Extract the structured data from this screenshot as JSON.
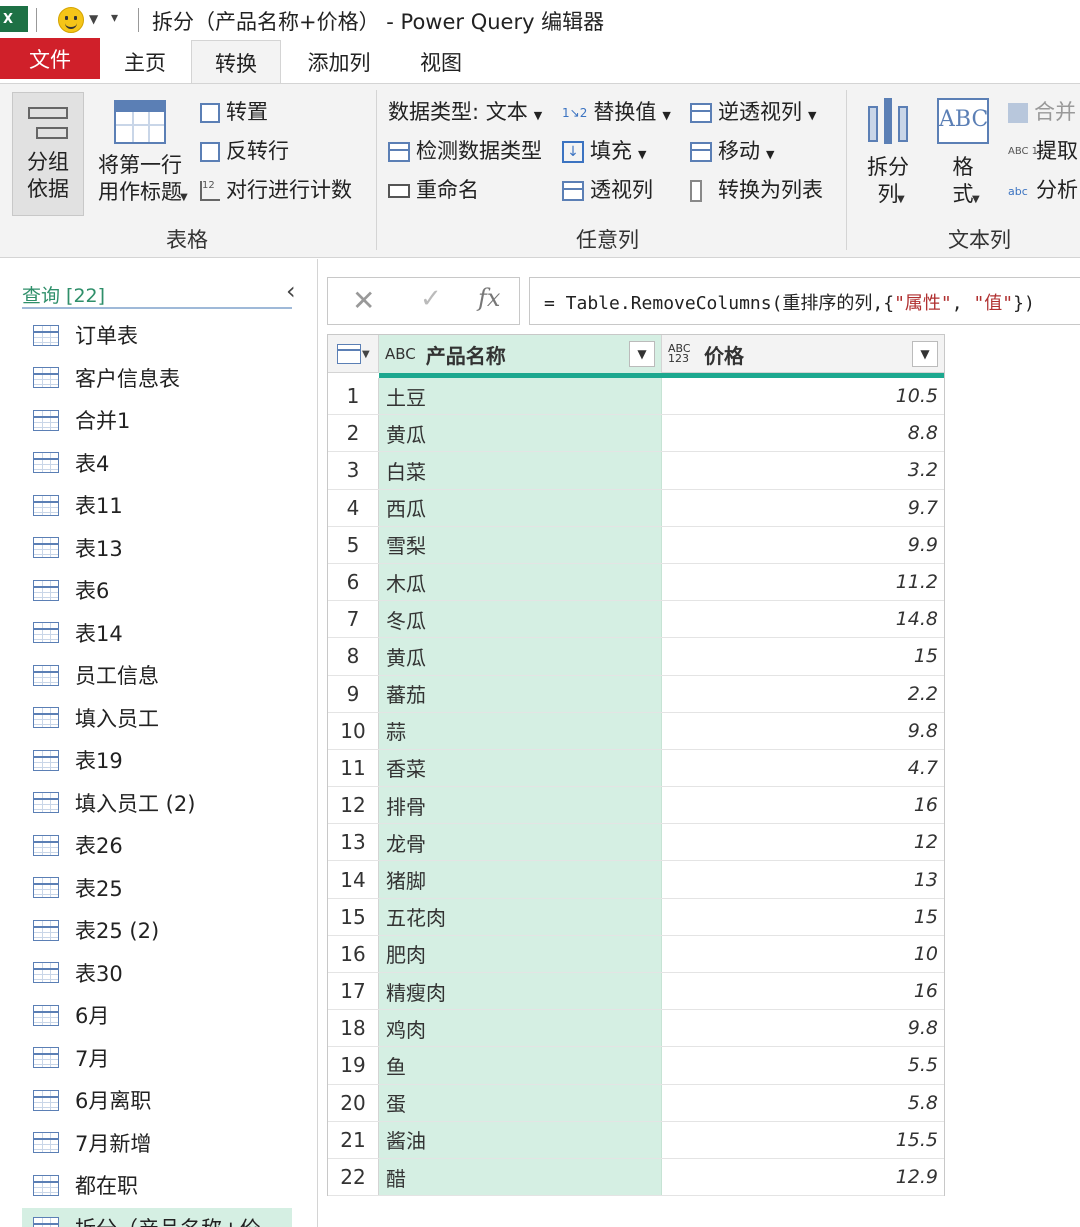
{
  "window": {
    "title": "拆分（产品名称+价格） - Power Query 编辑器",
    "app_icon_letter": "X"
  },
  "ribbon_tabs": [
    {
      "label": "文件"
    },
    {
      "label": "主页"
    },
    {
      "label": "转换",
      "active": true
    },
    {
      "label": "添加列"
    },
    {
      "label": "视图"
    }
  ],
  "ribbon": {
    "table_group": {
      "label": "表格",
      "group_by": "分组\n依据",
      "use_first_row": "将第一行\n用作标题",
      "transpose": "转置",
      "reverse_rows": "反转行",
      "count_rows": "对行进行计数"
    },
    "any_column_group": {
      "label": "任意列",
      "data_type": "数据类型: 文本",
      "detect_type": "检测数据类型",
      "rename": "重命名",
      "replace_values": "替换值",
      "fill": "填充",
      "pivot": "透视列",
      "unpivot": "逆透视列",
      "move": "移动",
      "to_list": "转换为列表"
    },
    "text_column_group": {
      "label": "文本列",
      "split_column": "拆分\n列",
      "format": "格\n式",
      "merge": "合并",
      "extract": "提取",
      "parse": "分析"
    }
  },
  "queries": {
    "header": "查询 [22]",
    "items": [
      "订单表",
      "客户信息表",
      "合并1",
      "表4",
      "表11",
      "表13",
      "表6",
      "表14",
      "员工信息",
      "填入员工",
      "表19",
      "填入员工 (2)",
      "表26",
      "表25",
      "表25 (2)",
      "表30",
      "6月",
      "7月",
      "6月离职",
      "7月新增",
      "都在职",
      "拆分（产品名称+价"
    ],
    "selected_index": 21
  },
  "formula_bar": {
    "prefix": "= Table.RemoveColumns(重排序的列,{",
    "str1": "\"属性\"",
    "mid": ", ",
    "str2": "\"值\"",
    "suffix": "})"
  },
  "grid": {
    "columns": [
      {
        "name": "产品名称",
        "type_icon": "ABC"
      },
      {
        "name": "价格",
        "type_icon": "ABC 123"
      }
    ],
    "rows": [
      {
        "n": "1",
        "name": "土豆",
        "price": "10.5"
      },
      {
        "n": "2",
        "name": "黄瓜",
        "price": "8.8"
      },
      {
        "n": "3",
        "name": "白菜",
        "price": "3.2"
      },
      {
        "n": "4",
        "name": "西瓜",
        "price": "9.7"
      },
      {
        "n": "5",
        "name": "雪梨",
        "price": "9.9"
      },
      {
        "n": "6",
        "name": "木瓜",
        "price": "11.2"
      },
      {
        "n": "7",
        "name": "冬瓜",
        "price": "14.8"
      },
      {
        "n": "8",
        "name": "黄瓜",
        "price": "15"
      },
      {
        "n": "9",
        "name": "蕃茄",
        "price": "2.2"
      },
      {
        "n": "10",
        "name": "蒜",
        "price": "9.8"
      },
      {
        "n": "11",
        "name": "香菜",
        "price": "4.7"
      },
      {
        "n": "12",
        "name": "排骨",
        "price": "16"
      },
      {
        "n": "13",
        "name": "龙骨",
        "price": "12"
      },
      {
        "n": "14",
        "name": "猪脚",
        "price": "13"
      },
      {
        "n": "15",
        "name": "五花肉",
        "price": "15"
      },
      {
        "n": "16",
        "name": "肥肉",
        "price": "10"
      },
      {
        "n": "17",
        "name": "精瘦肉",
        "price": "16"
      },
      {
        "n": "18",
        "name": "鸡肉",
        "price": "9.8"
      },
      {
        "n": "19",
        "name": "鱼",
        "price": "5.5"
      },
      {
        "n": "20",
        "name": "蛋",
        "price": "5.8"
      },
      {
        "n": "21",
        "name": "酱油",
        "price": "15.5"
      },
      {
        "n": "22",
        "name": "醋",
        "price": "12.9"
      }
    ]
  },
  "colors": {
    "file_tab": "#d0202a",
    "selected_column": "#d5efe3",
    "column_accent": "#1ca88f",
    "query_header": "#2f8f6a"
  }
}
